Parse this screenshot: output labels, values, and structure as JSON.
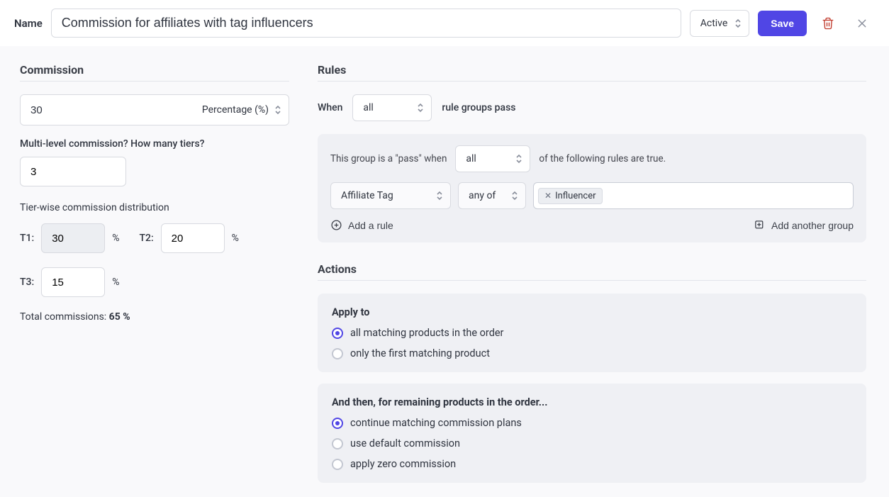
{
  "header": {
    "name_label": "Name",
    "name_value": "Commission for affiliates with tag influencers",
    "status": "Active",
    "save_label": "Save"
  },
  "commission": {
    "title": "Commission",
    "value": "30",
    "type": "Percentage (%)",
    "mlm_label": "Multi-level commission? How many tiers?",
    "tiers_count": "3",
    "dist_label": "Tier-wise commission distribution",
    "tiers": [
      {
        "label": "T1:",
        "value": "30",
        "readonly": true
      },
      {
        "label": "T2:",
        "value": "20",
        "readonly": false
      },
      {
        "label": "T3:",
        "value": "15",
        "readonly": false
      }
    ],
    "tier_unit": "%",
    "total_label": "Total commissions: ",
    "total_value": "65 %"
  },
  "rules": {
    "title": "Rules",
    "when_label": "When",
    "when_mode": "all",
    "when_suffix": "rule groups pass",
    "group_prefix": "This group is a \"pass\" when",
    "group_mode": "all",
    "group_suffix": "of the following rules are true.",
    "rule_field": "Affiliate Tag",
    "rule_op": "any of",
    "tag_value": "Influencer",
    "add_rule": "Add a rule",
    "add_group": "Add another group"
  },
  "actions": {
    "title": "Actions",
    "apply_to_heading": "Apply to",
    "apply_to_options": [
      "all matching products in the order",
      "only the first matching product"
    ],
    "apply_to_selected": 0,
    "then_heading": "And then, for remaining products in the order...",
    "then_options": [
      "continue matching commission plans",
      "use default commission",
      "apply zero commission"
    ],
    "then_selected": 0
  }
}
